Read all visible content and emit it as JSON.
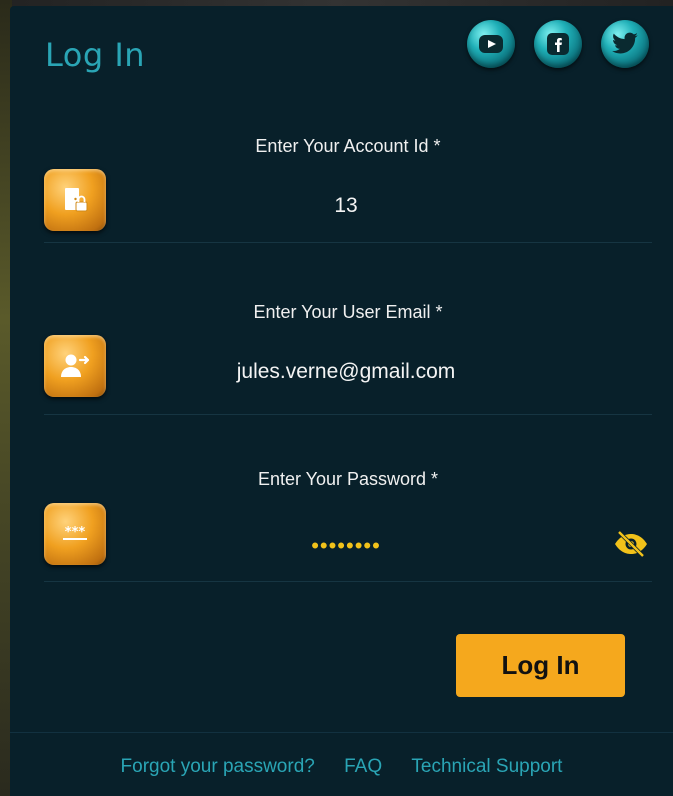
{
  "header": {
    "title": "Log In"
  },
  "social": [
    {
      "name": "youtube-icon"
    },
    {
      "name": "facebook-icon"
    },
    {
      "name": "twitter-icon"
    }
  ],
  "fields": {
    "account": {
      "label": "Enter Your Account Id *",
      "value": "13",
      "icon": "door-lock-icon"
    },
    "email": {
      "label": "Enter Your User Email *",
      "value": "jules.verne@gmail.com",
      "icon": "user-arrow-icon"
    },
    "password": {
      "label": "Enter Your Password *",
      "value": "••••••••",
      "icon": "password-asterisk-icon",
      "toggle_icon": "eye-slash-icon"
    }
  },
  "actions": {
    "login_label": "Log In"
  },
  "footer": {
    "forgot": "Forgot your password?",
    "faq": "FAQ",
    "support": "Technical Support"
  },
  "colors": {
    "panel_bg": "#08202a",
    "accent_teal": "#2aa5b5",
    "accent_orange": "#f5a81d",
    "password_dots": "#f2c21a"
  }
}
